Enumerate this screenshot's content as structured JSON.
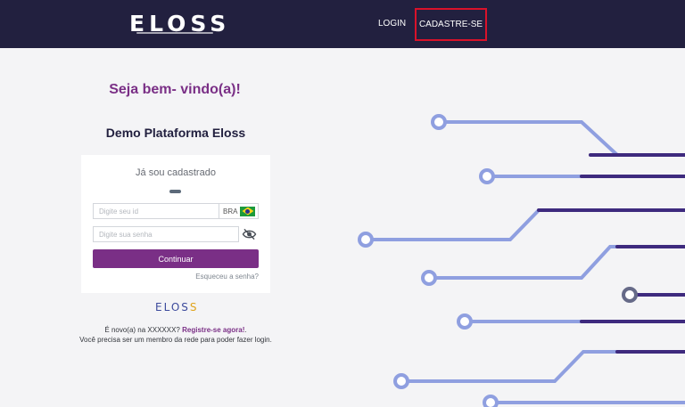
{
  "header": {
    "logo": "ELOSS",
    "nav": {
      "login": "LOGIN",
      "signup": "CADASTRE-SE"
    }
  },
  "main": {
    "welcome": "Seja bem- vindo(a)!",
    "platform": "Demo Plataforma Eloss"
  },
  "login_card": {
    "title": "Já sou cadastrado",
    "id_placeholder": "Digite seu id",
    "country_code": "BRA",
    "password_placeholder": "Digite sua senha",
    "submit_label": "Continuar",
    "forgot_label": "Esqueceu a senha?"
  },
  "footer": {
    "logo_main": "ELOS",
    "logo_last": "S",
    "new_prefix": "É novo(a) na XXXXXX?",
    "register_link": "Registre-se agora!",
    "new_suffix": ".",
    "member_note": "Você precisa ser um membro da rede para poder fazer login."
  },
  "colors": {
    "header_bg": "#22203f",
    "accent": "#7a2f86",
    "highlight_border": "#d9122a",
    "circuit_light": "#8f9fe0",
    "circuit_dark": "#3e2a7e"
  }
}
